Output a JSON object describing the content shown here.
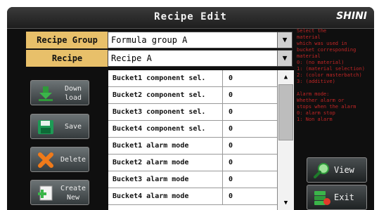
{
  "window": {
    "title": "Recipe Edit",
    "brand": "SHINI"
  },
  "recipe_group": {
    "label": "Recipe Group",
    "value": "Formula group A"
  },
  "recipe": {
    "label": "Recipe",
    "value": "Recipe A"
  },
  "side_buttons": {
    "download_line1": "Down",
    "download_line2": "load",
    "save": "Save",
    "delete": "Delete",
    "create_line1": "Create",
    "create_line2": "New"
  },
  "table": {
    "rows": [
      {
        "name": "Bucket1 component sel.",
        "value": "0"
      },
      {
        "name": "Bucket2 component sel.",
        "value": "0"
      },
      {
        "name": "Bucket3 component sel.",
        "value": "0"
      },
      {
        "name": "Bucket4 component sel.",
        "value": "0"
      },
      {
        "name": "Bucket1 alarm mode",
        "value": "0"
      },
      {
        "name": "Bucket2 alarm mode",
        "value": "0"
      },
      {
        "name": "Bucket3 alarm mode",
        "value": "0"
      },
      {
        "name": "Bucket4 alarm mode",
        "value": "0"
      }
    ]
  },
  "right_buttons": {
    "view": "View",
    "exit": "Exit"
  },
  "help_text": [
    "Select the",
    "material",
    "which was used in",
    "bucket corresponding",
    "material",
    "0: (no material)",
    "1: (material selection)",
    "2: (color masterbatch)",
    "3: (additive)",
    "",
    "Alarm mode:",
    "Whether alarm or",
    "stops when the alarm",
    "0: alarm stop",
    "1: Non alarm"
  ],
  "colors": {
    "label_bg": "#e8c06a",
    "help_text": "#c22626",
    "screen_bg": "#0f0f0f"
  }
}
